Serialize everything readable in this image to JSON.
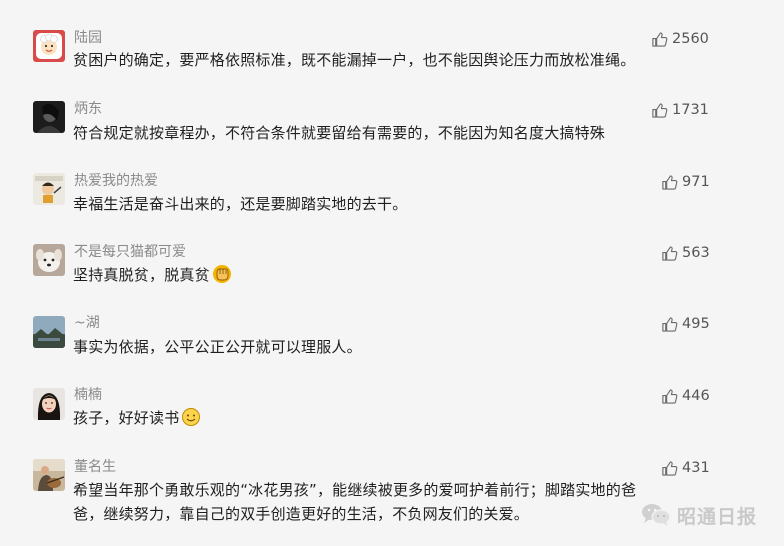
{
  "comments": [
    {
      "user": "陆园",
      "text": "贫困户的确定，要严格依照标准，既不能漏掉一户，也不能因舆论压力而放松准绳。",
      "likes": "2560",
      "avatar": "sheep-avatar-icon"
    },
    {
      "user": "炳东",
      "text": "符合规定就按章程办，不符合条件就要留给有需要的，不能因为知名度大搞特殊",
      "likes": "1731",
      "avatar": "dark-portrait-avatar-icon"
    },
    {
      "user": "热爱我的热爱",
      "text": "幸福生活是奋斗出来的，还是要脚踏实地的去干。",
      "likes": "971",
      "avatar": "cartoon-avatar-icon"
    },
    {
      "user": "不是每只猫都可爱",
      "text": "坚持真脱贫，脱真贫",
      "likes": "563",
      "avatar": "dog-avatar-icon",
      "emoji": "fist-emoji-icon"
    },
    {
      "user": "~湖",
      "text": "事实为依据，公平公正公开就可以理服人。",
      "likes": "495",
      "avatar": "landscape-avatar-icon"
    },
    {
      "user": "楠楠",
      "text": "孩子，好好读书",
      "likes": "446",
      "avatar": "girl-avatar-icon",
      "emoji": "smile-emoji-icon"
    },
    {
      "user": "董名生",
      "text_line1": "希望当年那个勇敢乐观的“冰花男孩”，能继续被更多的爱呵护着前行；脚踏实地的爸",
      "text_line2": "爸，继续努力，靠自己的双手创造更好的生活，不负网友们的关爱。",
      "likes": "431",
      "avatar": "guitar-avatar-icon"
    }
  ],
  "watermark": {
    "text": "昭通日报",
    "icon": "wechat-icon"
  }
}
